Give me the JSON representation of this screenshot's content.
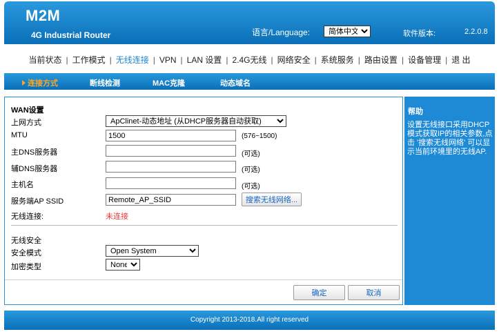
{
  "header": {
    "brand": "M2M",
    "product": "4G Industrial Router",
    "language_label": "语言/Language:",
    "language_value": "简体中文",
    "version_label": "软件版本:",
    "version_value": "2.2.0.8"
  },
  "topnav": [
    {
      "label": "当前状态"
    },
    {
      "label": "工作模式"
    },
    {
      "label": "无线连接"
    },
    {
      "label": "VPN"
    },
    {
      "label": "LAN 设置"
    },
    {
      "label": "2.4G无线"
    },
    {
      "label": "网络安全"
    },
    {
      "label": "系统服务"
    },
    {
      "label": "路由设置"
    },
    {
      "label": "设备管理"
    },
    {
      "label": "退 出"
    }
  ],
  "subnav": [
    {
      "label": "连接方式"
    },
    {
      "label": "断线检测"
    },
    {
      "label": "MAC克隆"
    },
    {
      "label": "动态域名"
    }
  ],
  "wan": {
    "section_title": "WAN设置",
    "mode_label": "上网方式",
    "mode_value": "ApClinet-动态地址 (从DHCP服务器自动获取)",
    "mtu_label": "MTU",
    "mtu_value": "1500",
    "mtu_hint": "(576~1500)",
    "dns1_label": "主DNS服务器",
    "dns1_value": "",
    "dns1_hint": "(可选)",
    "dns2_label": "辅DNS服务器",
    "dns2_value": "",
    "dns2_hint": "(可选)",
    "hostname_label": "主机名",
    "hostname_value": "",
    "hostname_hint": "(可选)",
    "ssid_label": "服务端AP SSID",
    "ssid_value": "Remote_AP_SSID",
    "search_button": "搜索无线网络...",
    "conn_label": "无线连接:",
    "conn_status": "未连接"
  },
  "security": {
    "section_title": "无线安全",
    "mode_label": "安全模式",
    "mode_value": "Open System",
    "enc_label": "加密类型",
    "enc_value": "None"
  },
  "actions": {
    "ok": "确定",
    "cancel": "取消"
  },
  "help": {
    "title": "帮助",
    "text": "设置无线接口采用DHCP模式获取IP的相关参数,点击 '搜索无线网络' 可以显示当前环境里的无线AP."
  },
  "footer": {
    "copyright": "Copyright 2013-2018.All right reserved"
  },
  "colors": {
    "primary": "#1e8ad6",
    "accent": "#ffa726",
    "status_error": "#e53935"
  }
}
